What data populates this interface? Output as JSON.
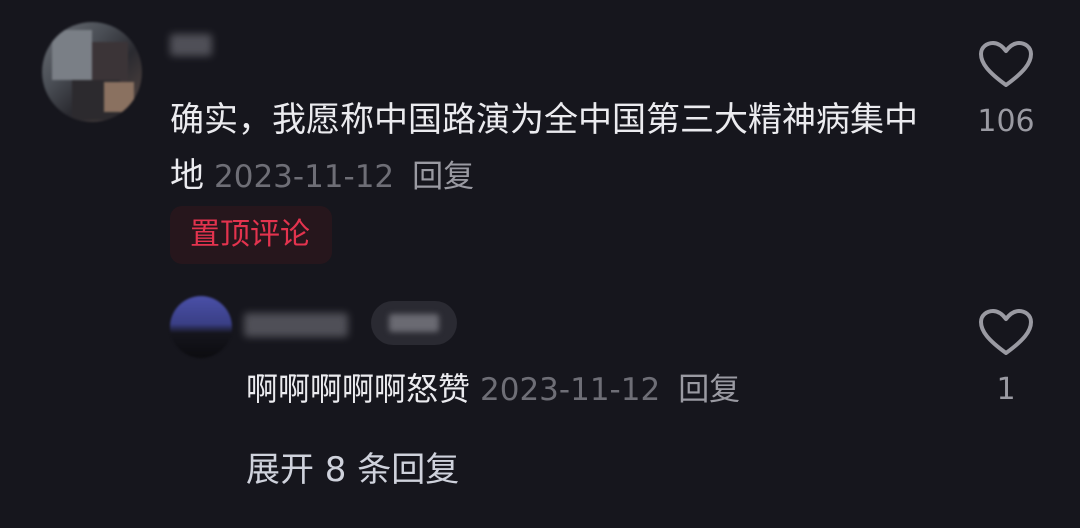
{
  "comment": {
    "text": "确实，我愿称中国路演为全中国第三大精神病集中地",
    "date": "2023-11-12",
    "reply_label": "回复",
    "pinned_label": "置顶评论",
    "like_count": "106"
  },
  "reply": {
    "text": "啊啊啊啊啊怒赞",
    "date": "2023-11-12",
    "reply_label": "回复",
    "like_count": "1"
  },
  "expand_label": "展开 8 条回复",
  "icons": {
    "like": "heart-outline-icon"
  },
  "colors": {
    "background": "#16161d",
    "pinned_accent": "#e3334e",
    "meta_text": "#6e6e76"
  }
}
